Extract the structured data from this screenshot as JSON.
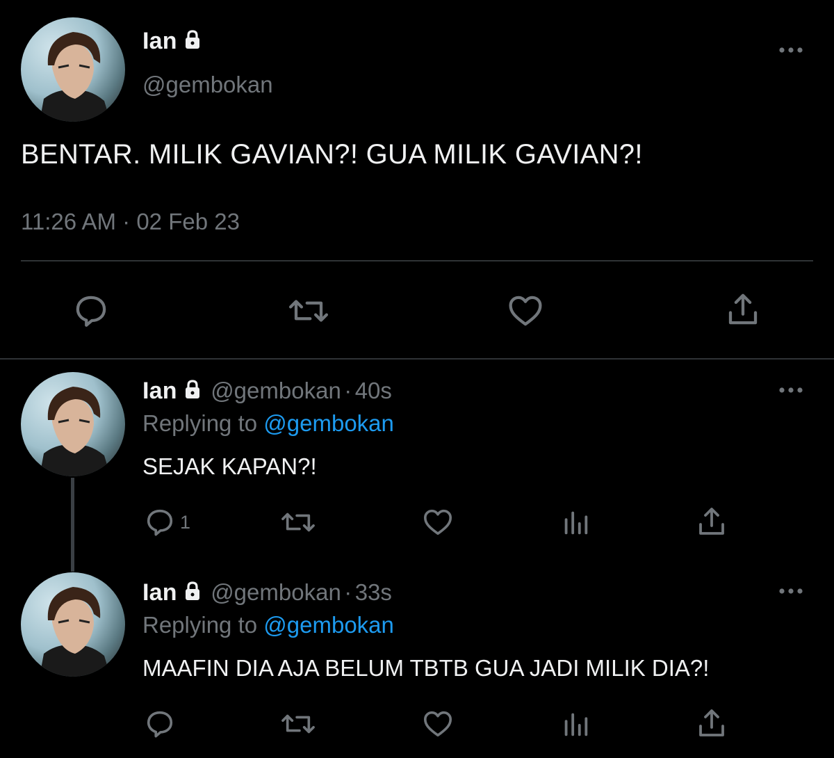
{
  "main_tweet": {
    "name": "Ian",
    "handle": "@gembokan",
    "text": "BENTAR. MILIK GAVIAN?! GUA MILIK GAVIAN?!",
    "time": "11:26 AM",
    "separator": "·",
    "date": "02 Feb 23"
  },
  "replies": [
    {
      "name": "Ian",
      "handle": "@gembokan",
      "separator": "·",
      "age": "40s",
      "replying_prefix": "Replying to",
      "replying_to": "@gembokan",
      "text": "SEJAK KAPAN?!",
      "reply_count": "1"
    },
    {
      "name": "Ian",
      "handle": "@gembokan",
      "separator": "·",
      "age": "33s",
      "replying_prefix": "Replying to",
      "replying_to": "@gembokan",
      "text": "MAAFIN DIA AJA BELUM TBTB GUA JADI MILIK DIA?!",
      "reply_count": ""
    }
  ],
  "icons": [
    "lock-icon",
    "more-icon",
    "reply-icon",
    "retweet-icon",
    "like-icon",
    "share-icon",
    "analytics-icon"
  ],
  "colors": {
    "background": "#000000",
    "text": "#e7e9ea",
    "muted": "#71767b",
    "link": "#1d9bf0",
    "divider": "#2f3336"
  }
}
